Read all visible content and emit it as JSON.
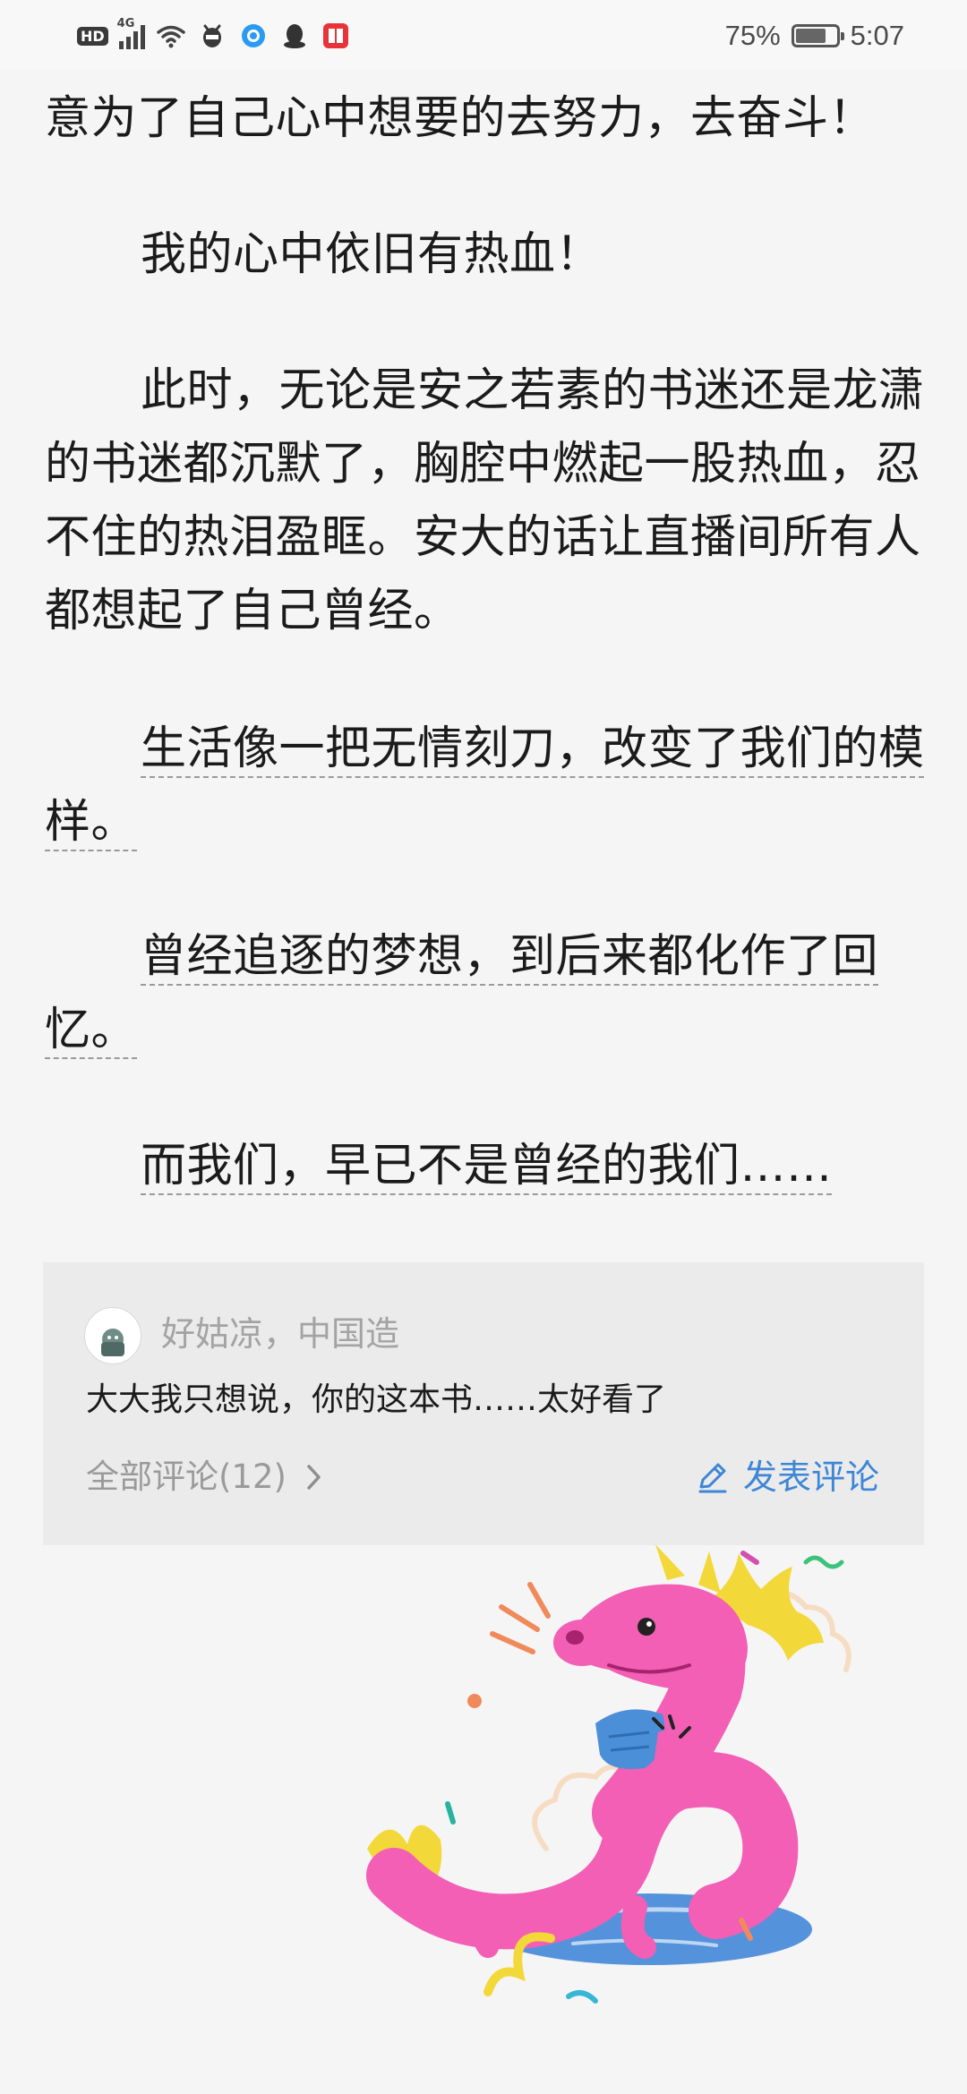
{
  "status_bar": {
    "hd": "HD",
    "network": "4G",
    "battery": "75%",
    "battery_level": 0.75,
    "time": "5:07"
  },
  "reader": {
    "paragraphs": [
      "意为了自己心中想要的去努力，去奋斗！",
      "我的心中依旧有热血！",
      "此时，无论是安之若素的书迷还是龙潇的书迷都沉默了，胸腔中燃起一股热血，忍不住的热泪盈眶。安大的话让直播间所有人都想起了自己曾经。",
      "生活像一把无情刻刀，改变了我们的模样。",
      "曾经追逐的梦想，到后来都化作了回忆。",
      "而我们，早已不是曾经的我们……"
    ]
  },
  "comments": {
    "top_comment": {
      "user": "好姑凉，中国造",
      "text": "大大我只想说，你的这本书……太好看了"
    },
    "all_comments_label": "全部评论(12)",
    "post_comment_label": "发表评论"
  },
  "colors": {
    "accent": "#3e86d6",
    "dragon": "#f25fb5",
    "dragon_mane": "#f4dc3a",
    "mask": "#4a8fd8"
  }
}
